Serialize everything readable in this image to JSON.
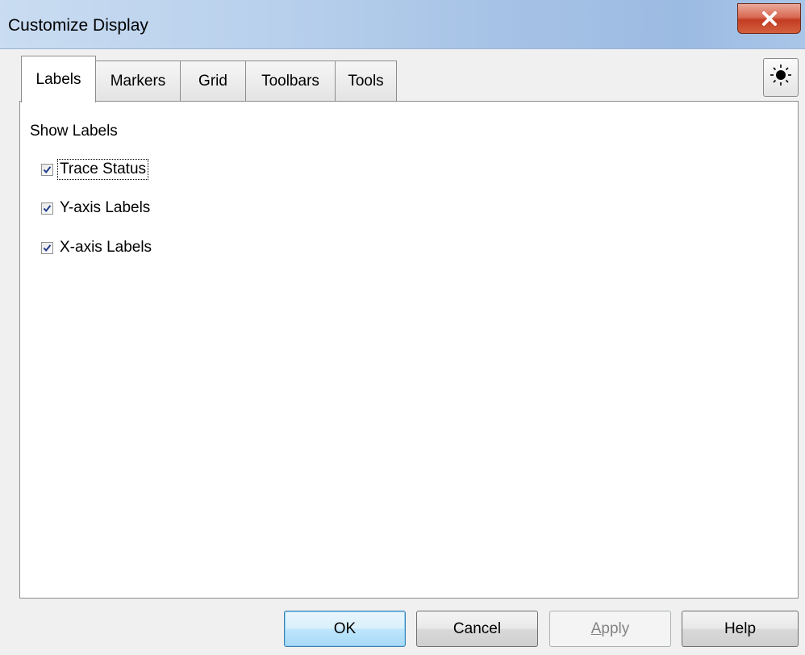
{
  "window": {
    "title": "Customize Display"
  },
  "icons": {
    "close": "close-icon",
    "brightness": "sun-icon",
    "check": "checkmark-icon"
  },
  "tabs": [
    {
      "label": "Labels",
      "active": true
    },
    {
      "label": "Markers",
      "active": false
    },
    {
      "label": "Grid",
      "active": false
    },
    {
      "label": "Toolbars",
      "active": false
    },
    {
      "label": "Tools",
      "active": false
    }
  ],
  "labels_panel": {
    "section_title": "Show Labels",
    "options": [
      {
        "label": "Trace Status",
        "checked": true,
        "focused": true
      },
      {
        "label": "Y-axis Labels",
        "checked": true,
        "focused": false
      },
      {
        "label": "X-axis Labels",
        "checked": true,
        "focused": false
      }
    ]
  },
  "buttons": {
    "ok": "OK",
    "cancel": "Cancel",
    "apply_first": "A",
    "apply_rest": "pply",
    "help": "Help"
  },
  "colors": {
    "close_button": "#c23c22",
    "default_button_border": "#3c7fb1",
    "disabled_text": "#838383"
  }
}
